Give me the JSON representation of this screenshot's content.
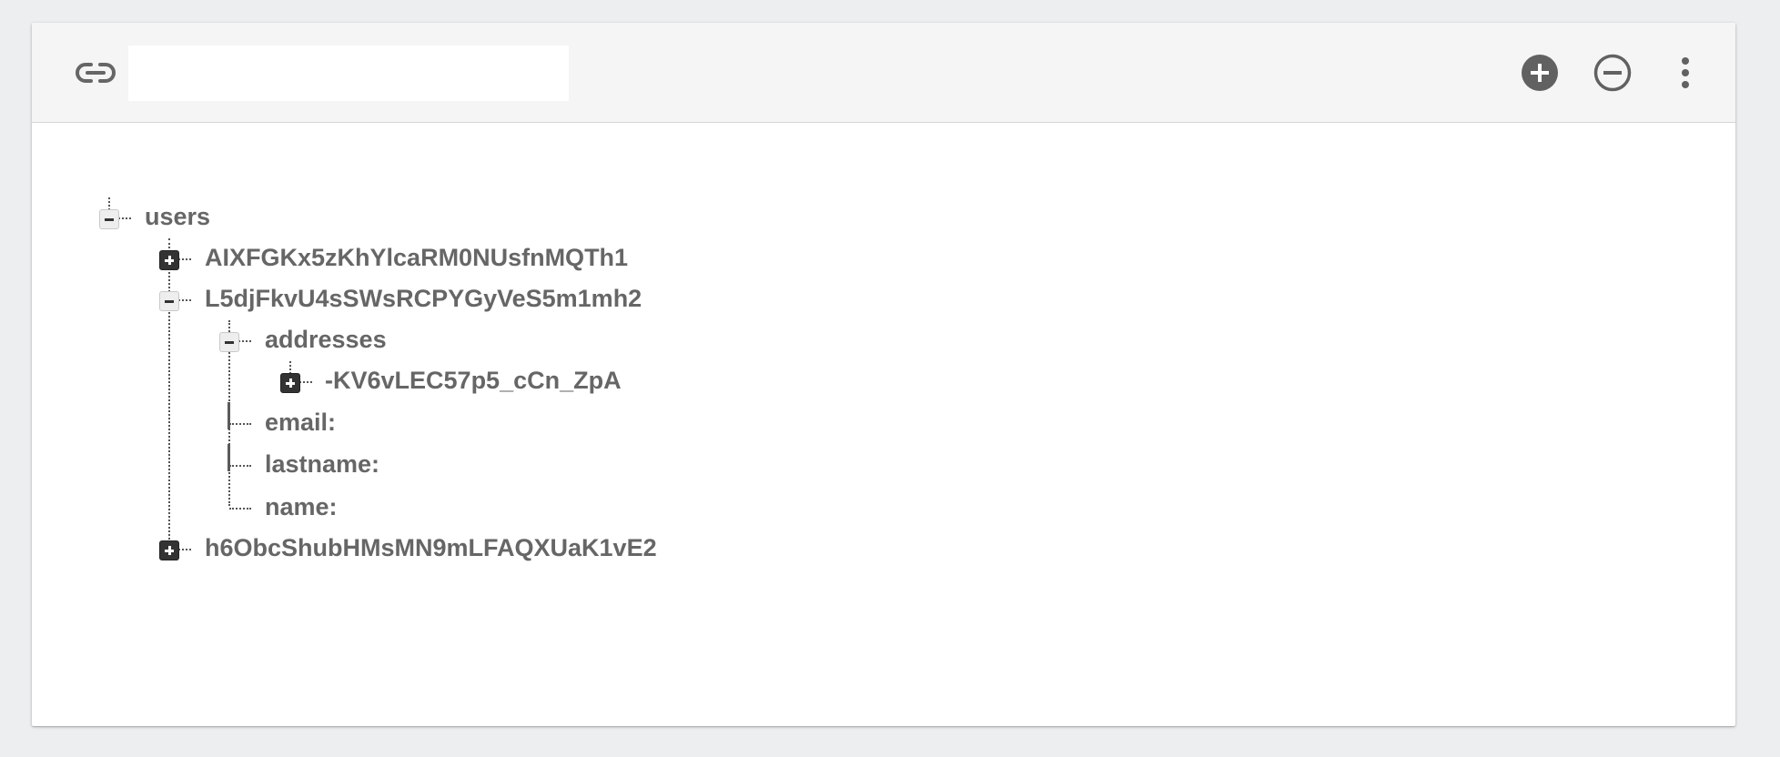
{
  "toolbar": {
    "url_value": "",
    "link_icon": "link-icon",
    "add_icon": "add-circle-icon",
    "remove_icon": "remove-circle-icon",
    "more_icon": "more-vert-icon"
  },
  "tree": {
    "root": {
      "label": "users",
      "state": "expanded"
    },
    "children": [
      {
        "label": "AIXFGKx5zKhYlcaRM0NUsfnMQTh1",
        "state": "collapsed"
      },
      {
        "label": "L5djFkvU4sSWsRCPYGyVeS5m1mh2",
        "state": "expanded",
        "children": [
          {
            "label": "addresses",
            "state": "expanded",
            "children": [
              {
                "label": "-KV6vLEC57p5_cCn_ZpA",
                "state": "collapsed"
              }
            ]
          },
          {
            "label": "email:"
          },
          {
            "label": "lastname:"
          },
          {
            "label": "name:"
          }
        ]
      },
      {
        "label": "h6ObcShubHMsMN9mLFAQXUaK1vE2",
        "state": "collapsed"
      }
    ]
  },
  "colors": {
    "background": "#eceef0",
    "card": "#ffffff",
    "toolbar": "#f5f5f5",
    "text": "#666666",
    "icon": "#616161"
  }
}
